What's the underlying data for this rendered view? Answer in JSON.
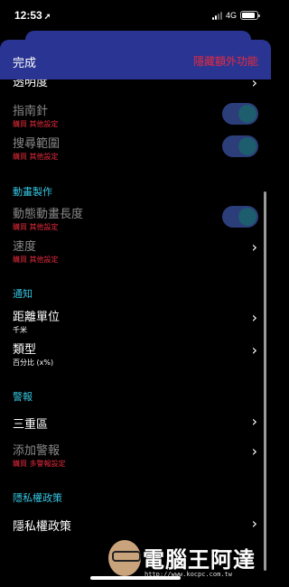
{
  "status_bar": {
    "time": "12:53",
    "location_glyph": "➚",
    "network": "4G",
    "battery_level": 0.9
  },
  "header": {
    "done_label": "完成",
    "hide_label": "隱藏額外功能"
  },
  "rows": {
    "transparency": {
      "title": "透明度"
    },
    "compass": {
      "title": "指南針",
      "sub": "購買 其他設定",
      "toggle_on": true
    },
    "search_range": {
      "title": "搜尋範圍",
      "sub": "購買 其他設定",
      "toggle_on": true
    },
    "anim_length": {
      "title": "動態動畫長度",
      "sub": "購買 其他設定",
      "toggle_on": true
    },
    "speed": {
      "title": "速度",
      "sub": "購買 其他設定"
    },
    "distance_unit": {
      "title": "距離單位",
      "sub": "千米"
    },
    "type": {
      "title": "類型",
      "sub": "百分比 (x%)"
    },
    "triple": {
      "title": "三重區"
    },
    "add_alert": {
      "title": "添加警報",
      "sub": "購買 多警報設定"
    },
    "privacy": {
      "title": "隱私權政策"
    }
  },
  "sections": {
    "animation": "動畫製作",
    "notify": "通知",
    "alert": "警報",
    "privacy": "隱私權政策"
  },
  "watermark": {
    "text": "電腦王阿達",
    "url": "http://www.kocpc.com.tw"
  },
  "colors": {
    "header_bg": "#2a3593",
    "accent_red": "#e82a3c",
    "section_cyan": "#36c4e0",
    "toggle_track": "#2c3e7a"
  }
}
